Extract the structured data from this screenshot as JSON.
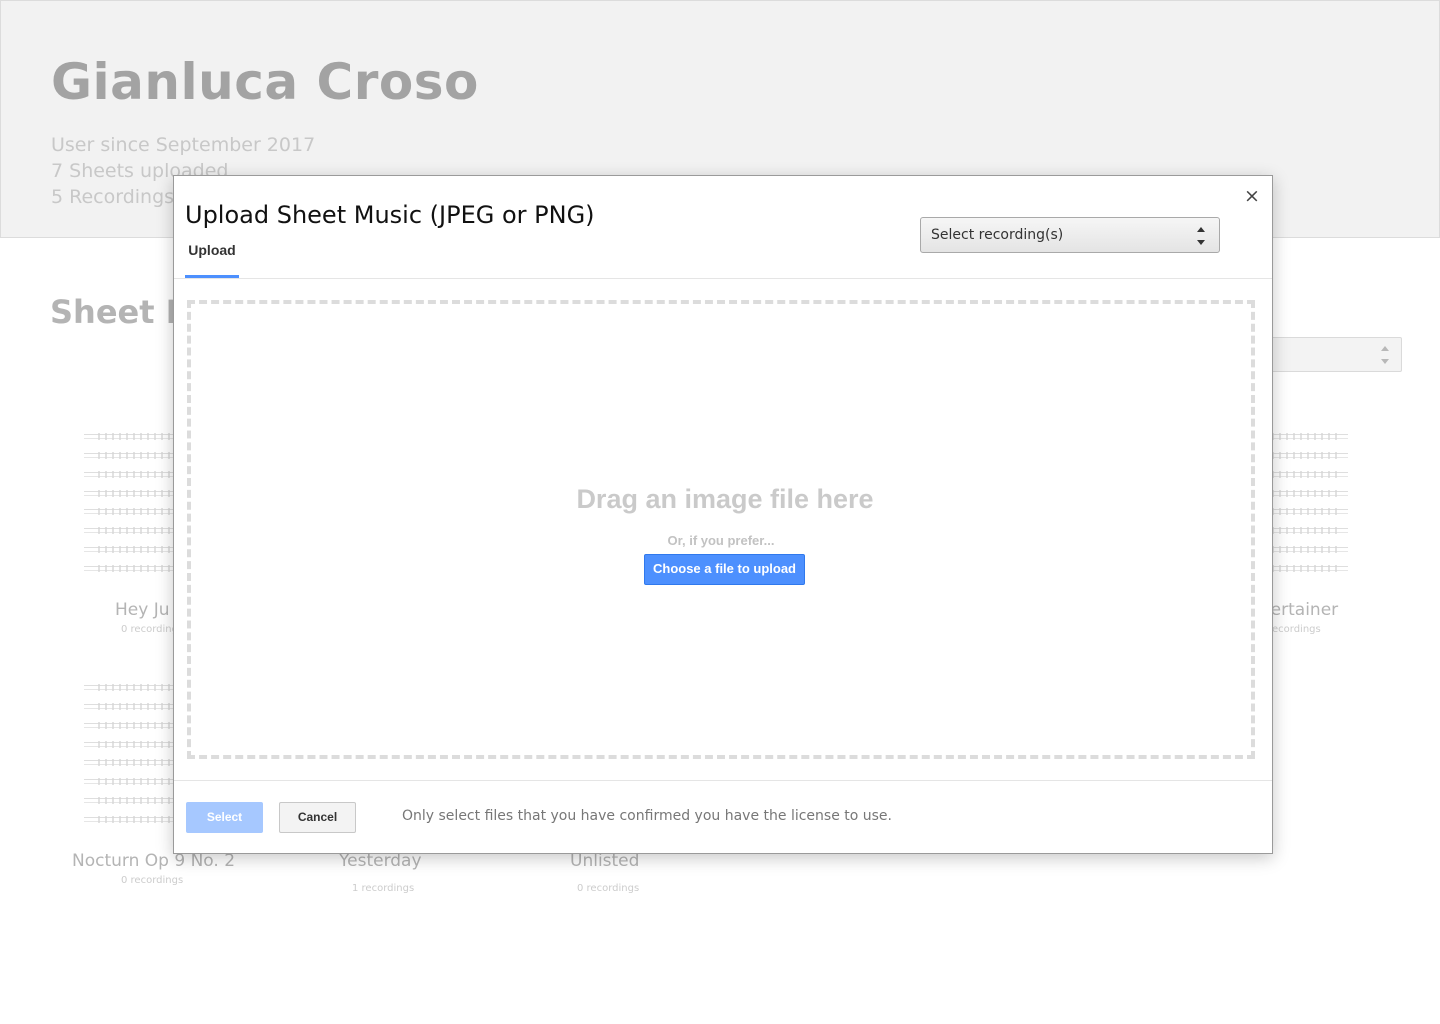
{
  "profile": {
    "name": "Gianluca Croso",
    "stats": [
      "User since September 2017",
      "7 Sheets uploaded",
      "5 Recordings"
    ]
  },
  "sheets_section": {
    "title": "Sheet M",
    "cards": [
      {
        "title": "Hey Ju",
        "sub": "0 recording"
      },
      {
        "title": "tertainer",
        "sub": "ecordings"
      },
      {
        "title": "Nocturn Op 9 No. 2",
        "sub": "0 recordings"
      },
      {
        "title": "Yesterday",
        "sub": "1 recordings"
      },
      {
        "title": "Unlisted",
        "sub": "0 recordings"
      }
    ]
  },
  "modal": {
    "title": "Upload Sheet Music (JPEG or PNG)",
    "close_icon": "×",
    "tab_label": "Upload",
    "recording_select": "Select recording(s)",
    "drop_title": "Drag an image file here",
    "drop_sub": "Or, if you prefer...",
    "choose_button": "Choose a file to upload",
    "select_button": "Select",
    "cancel_button": "Cancel",
    "license_note": "Only select files that you have confirmed you have the license to use."
  },
  "colors": {
    "accent": "#4d90fe",
    "select_disabled": "#a6c8ff",
    "header_bg": "#f2f2f2"
  }
}
